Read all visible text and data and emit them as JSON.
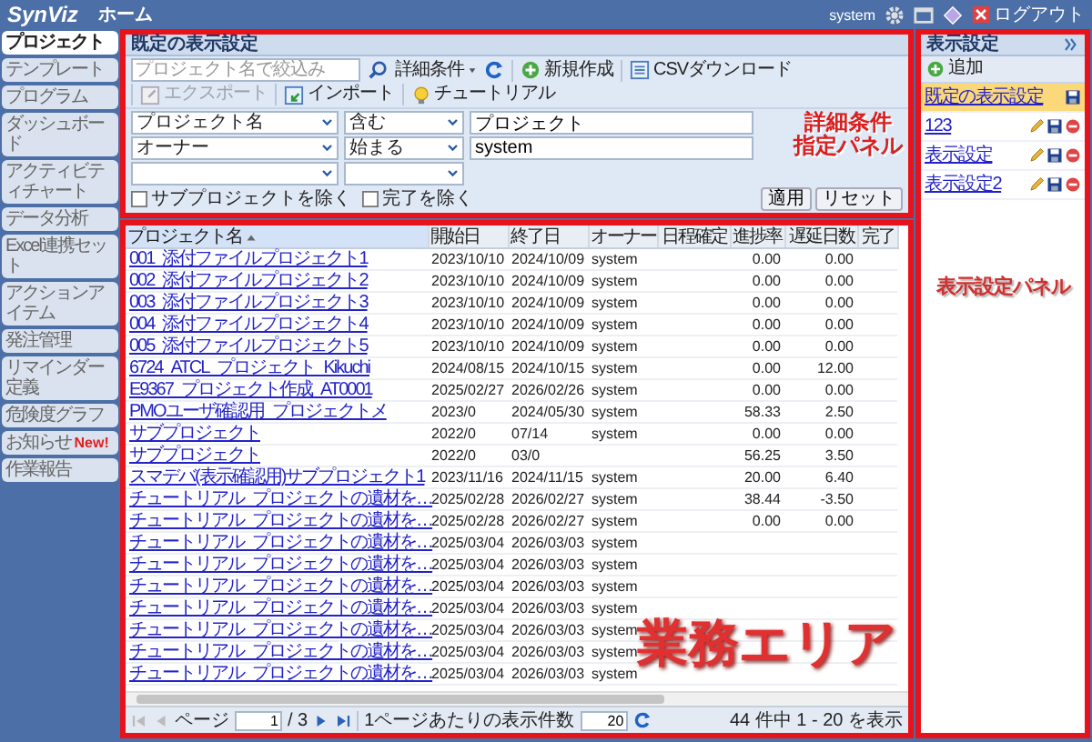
{
  "header": {
    "logo": "SynViz",
    "home": "ホーム",
    "user": "system",
    "logout": "ログアウト"
  },
  "sidebar": {
    "items": [
      {
        "label": "プロジェクト",
        "selected": true
      },
      {
        "label": "テンプレート",
        "selected": false
      },
      {
        "label": "プログラム",
        "selected": false
      },
      {
        "label": "ダッシュボード",
        "selected": false
      },
      {
        "label": "アクティビティチャート",
        "selected": false
      },
      {
        "label": "データ分析",
        "selected": false
      },
      {
        "label": "Excel連携セット",
        "selected": false
      },
      {
        "label": "アクションアイテム",
        "selected": false
      },
      {
        "label": "発注管理",
        "selected": false
      },
      {
        "label": "リマインダー定義",
        "selected": false
      },
      {
        "label": "危険度グラフ",
        "selected": false
      },
      {
        "label": "お知らせ",
        "badge": "New!",
        "selected": false
      },
      {
        "label": "作業報告",
        "selected": false
      }
    ]
  },
  "filter_panel": {
    "title": "既定の表示設定",
    "search": {
      "placeholder": "プロジェクト名で絞込み"
    },
    "toolbar": [
      {
        "kind": "menu",
        "label": "詳細条件"
      },
      {
        "kind": "refresh"
      },
      {
        "kind": "create",
        "label": "新規作成",
        "disabled": false
      },
      {
        "kind": "download",
        "label": "CSVダウンロード",
        "disabled": false
      },
      {
        "kind": "export",
        "label": "エクスポート",
        "disabled": true
      },
      {
        "kind": "import",
        "label": "インポート",
        "disabled": false
      },
      {
        "kind": "tutorial",
        "label": "チュートリアル",
        "disabled": false
      }
    ],
    "conditions": [
      {
        "field": "プロジェクト名",
        "operator": "含む",
        "value": "プロジェクト"
      },
      {
        "field": "オーナー",
        "operator": "始まる",
        "value": "system"
      }
    ],
    "checkboxes": [
      {
        "label": "サブプロジェクトを除く",
        "checked": false
      },
      {
        "label": "完了を除く",
        "checked": false
      }
    ],
    "buttons": [
      "適用",
      "リセット"
    ],
    "annotation": [
      "詳細条件",
      "指定パネル"
    ]
  },
  "table": {
    "columns": [
      {
        "label": "プロジェクト名",
        "sorted": true
      },
      {
        "label": "開始日",
        "sorted": false
      },
      {
        "label": "終了日",
        "sorted": false
      },
      {
        "label": "オーナー",
        "sorted": false
      },
      {
        "label": "日程確定",
        "sorted": false
      },
      {
        "label": "進捗率",
        "sorted": false
      },
      {
        "label": "遅延日数",
        "sorted": false
      },
      {
        "label": "完了",
        "sorted": false
      }
    ],
    "rows": [
      {
        "name": "001_添付ファイルプロジェクト1",
        "start": "2023/10/10",
        "end": "2024/10/09",
        "owner": "system",
        "progress": "0.00",
        "delay": "0.00"
      },
      {
        "name": "002_添付ファイルプロジェクト2",
        "start": "2023/10/10",
        "end": "2024/10/09",
        "owner": "system",
        "progress": "0.00",
        "delay": "0.00"
      },
      {
        "name": "003_添付ファイルプロジェクト3",
        "start": "2023/10/10",
        "end": "2024/10/09",
        "owner": "system",
        "progress": "0.00",
        "delay": "0.00"
      },
      {
        "name": "004_添付ファイルプロジェクト4",
        "start": "2023/10/10",
        "end": "2024/10/09",
        "owner": "system",
        "progress": "0.00",
        "delay": "0.00"
      },
      {
        "name": "005_添付ファイルプロジェクト5",
        "start": "2023/10/10",
        "end": "2024/10/09",
        "owner": "system",
        "progress": "0.00",
        "delay": "0.00"
      },
      {
        "name": "6724_ATCL_プロジェクト_Kikuchi",
        "start": "2024/08/15",
        "end": "2024/10/15",
        "owner": "system",
        "progress": "0.00",
        "delay": "12.00"
      },
      {
        "name": "E9367_プロジェクト作成_AT0001",
        "start": "2025/02/27",
        "end": "2026/02/26",
        "owner": "system",
        "progress": "0.00",
        "delay": "0.00"
      },
      {
        "name": "PMOユーザ確認用_プロジェクトメ",
        "start": "2023/0",
        "end": "2024/05/30",
        "owner": "system",
        "progress": "58.33",
        "delay": "2.50"
      },
      {
        "name": "サブプロジェクト",
        "start": "2022/0",
        "end": "07/14",
        "owner": "system",
        "progress": "0.00",
        "delay": "0.00"
      },
      {
        "name": "サブプロジェクト",
        "start": "2022/0",
        "end": "03/0",
        "progress": "56.25",
        "delay": "3.50"
      },
      {
        "name": "スマデバ(表示確認用)サブプロジェクト1",
        "start": "2023/11/16",
        "end": "2024/11/15",
        "owner": "system",
        "progress": "20.00",
        "delay": "6.40"
      },
      {
        "name": "チュートリアル_プロジェクトの遺材を…",
        "start": "2025/02/28",
        "end": "2026/02/27",
        "owner": "system",
        "progress": "38.44",
        "delay": "-3.50"
      },
      {
        "name": "チュートリアル_プロジェクトの遺材を…",
        "start": "2025/02/28",
        "end": "2026/02/27",
        "owner": "system",
        "progress": "0.00",
        "delay": "0.00"
      },
      {
        "name": "チュートリアル_プロジェクトの遺材を…",
        "start": "2025/03/04",
        "end": "2026/03/03",
        "owner": "system"
      },
      {
        "name": "チュートリアル_プロジェクトの遺材を…",
        "start": "2025/03/04",
        "end": "2026/03/03",
        "owner": "system"
      },
      {
        "name": "チュートリアル_プロジェクトの遺材を…",
        "start": "2025/03/04",
        "end": "2026/03/03",
        "owner": "system"
      },
      {
        "name": "チュートリアル_プロジェクトの遺材を…",
        "start": "2025/03/04",
        "end": "2026/03/03",
        "owner": "system"
      },
      {
        "name": "チュートリアル_プロジェクトの遺材を…",
        "start": "2025/03/04",
        "end": "2026/03/03",
        "owner": "system"
      },
      {
        "name": "チュートリアル_プロジェクトの遺材を…",
        "start": "2025/03/04",
        "end": "2026/03/03",
        "owner": "system"
      },
      {
        "name": "チュートリアル_プロジェクトの遺材を…",
        "start": "2025/03/04",
        "end": "2026/03/03",
        "owner": "system"
      }
    ],
    "annotation": "業務エリア"
  },
  "pager": {
    "page_label": "ページ",
    "page": "1",
    "page_total": "/ 3",
    "per_page_label": "1ページあたりの表示件数",
    "per_page": "20",
    "summary": "44 件中 1 - 20 を表示"
  },
  "right_panel": {
    "title": "表示設定",
    "add": "追加",
    "items": [
      {
        "label": "既定の表示設定",
        "selected": true,
        "editable": false
      },
      {
        "label": "123",
        "selected": false,
        "editable": true
      },
      {
        "label": "表示設定",
        "selected": false,
        "editable": true
      },
      {
        "label": "表示設定2",
        "selected": false,
        "editable": true
      }
    ],
    "annotation": "表示設定パネル"
  }
}
